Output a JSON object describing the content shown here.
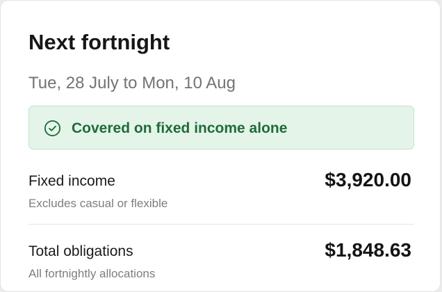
{
  "card": {
    "title": "Next fortnight",
    "date_range": "Tue, 28 July to Mon, 10 Aug"
  },
  "status": {
    "icon": "check-circle-icon",
    "text": "Covered on fixed income alone",
    "colors": {
      "background": "#e5f4e9",
      "border": "#bfe3c9",
      "text": "#1e6c3a"
    }
  },
  "rows": [
    {
      "label": "Fixed income",
      "sublabel": "Excludes casual or flexible",
      "value": "$3,920.00"
    },
    {
      "label": "Total obligations",
      "sublabel": "All fortnightly allocations",
      "value": "$1,848.63"
    }
  ]
}
